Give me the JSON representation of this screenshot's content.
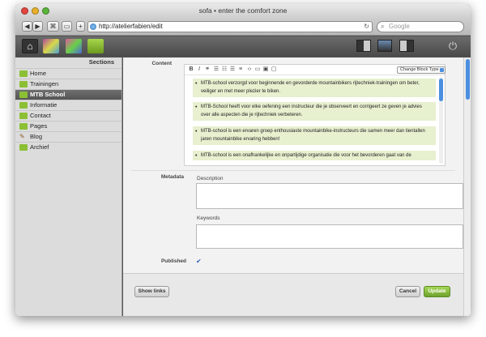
{
  "window": {
    "title": "sofa • enter the comfort zone"
  },
  "browser": {
    "url": "http://atelierfabien/edit",
    "search_placeholder": "Google",
    "back": "◀",
    "forward": "▶",
    "bookmark": "⌘",
    "add": "+"
  },
  "app": {
    "icons": [
      "home-icon",
      "plugins-icon",
      "themes-icon",
      "content-icon"
    ],
    "accent": "#8cbf34"
  },
  "sidebar": {
    "title": "Sections",
    "items": [
      {
        "label": "Home"
      },
      {
        "label": "Trainingen"
      },
      {
        "label": "MTB School",
        "active": true
      },
      {
        "label": "Informatie"
      },
      {
        "label": "Contact"
      },
      {
        "label": "Pages"
      },
      {
        "label": "Blog"
      },
      {
        "label": "Archief"
      }
    ]
  },
  "content": {
    "label": "Content",
    "toolbar": {
      "bold": "B",
      "italic": "I",
      "link": "⚭",
      "block_type": "Change Block Type"
    },
    "bullets": [
      "MTB-school verzorgd voor beginnende en gevorderde mountainbikers rijtechniek-trainingen om beter, veiliger en met meer plezier te biken.",
      "MTB-School heeft voor elke oefening een instructeur die je observeert en corrigeert ze geven je advies over alle aspecten die je rijtechniek verbeteren.",
      "MTB-school is een ervaren groep enthousiaste mountainbike-instructeurs die samen meer dan tientallen jaren mountainbike ervaring hebben!",
      "MTB-school is een onafhankelijke en onpartijdige organisatie die voor het bevorderen gaat van de"
    ]
  },
  "metadata": {
    "label": "Metadata",
    "description_label": "Description",
    "keywords_label": "Keywords"
  },
  "published": {
    "label": "Published",
    "checked": true,
    "mark": "✔"
  },
  "buttons": {
    "show_links": "Show links",
    "cancel": "Cancel",
    "update": "Update"
  }
}
